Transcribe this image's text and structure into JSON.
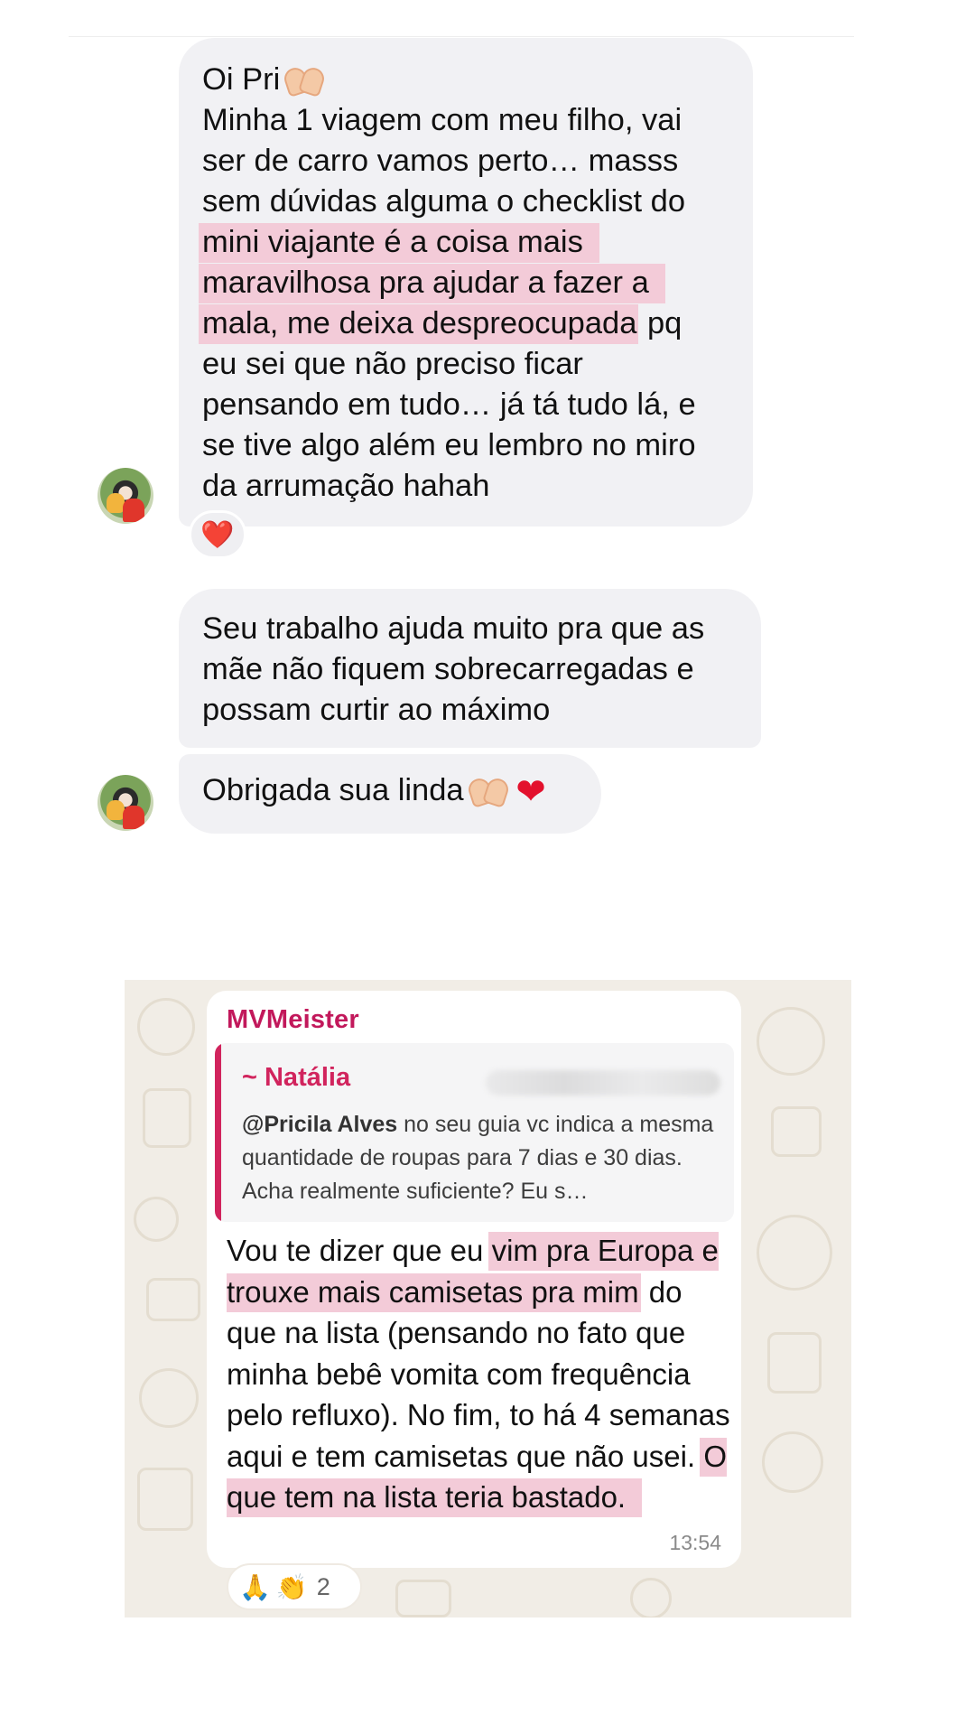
{
  "instagram_chat": {
    "messages": [
      {
        "lines": [
          "Oi Pri",
          "Minha 1 viagem com meu filho, vai",
          "ser de carro vamos perto… masss",
          "sem dúvidas alguma o checklist do",
          "mini viajante é a coisa mais",
          "maravilhosa pra ajudar a fazer a",
          "mala, me deixa despreocupada",
          " pq",
          "eu sei que não preciso ficar",
          "pensando em tudo… já tá tudo lá, e",
          "se tive algo além eu lembro no miro",
          "da arrumação hahah"
        ],
        "reaction": "❤️"
      },
      {
        "lines": [
          "Seu trabalho ajuda muito pra que as",
          "mãe não fiquem sobrecarregadas e",
          "possam curtir ao máximo"
        ]
      },
      {
        "text": "Obrigada sua linda"
      }
    ]
  },
  "whatsapp": {
    "sender": "MVMeister",
    "quote": {
      "author": "~ Natália",
      "mention": "@Pricila Alves",
      "text": " no seu guia vc indica a mesma quantidade de roupas para 7 dias e 30 dias. Acha realmente suficiente? Eu s…"
    },
    "body": {
      "p1": "Vou te dizer que eu ",
      "h1": "vim pra Europa e trouxe mais camisetas pra mim",
      "p2": " do que na lista (pensando no fato que minha bebê vomita com frequência pelo refluxo). No fim, to há 4 semanas aqui e tem camisetas que não usei. ",
      "h2": "O que tem na lista teria bastado."
    },
    "time": "13:54",
    "reactions": {
      "emojis": [
        "🙏",
        "👏"
      ],
      "count": "2"
    }
  },
  "colors": {
    "bubble_gray": "#f1f1f4",
    "highlight_pink": "#f3cbd8",
    "whatsapp_sender": "#c2185b",
    "quote_accent": "#d1245d",
    "whatsapp_wallpaper": "#f1ede6"
  },
  "icons": [
    "heart-hands-icon",
    "red-heart-icon",
    "folded-hands-icon",
    "clapping-hands-icon",
    "avatar-photo"
  ]
}
